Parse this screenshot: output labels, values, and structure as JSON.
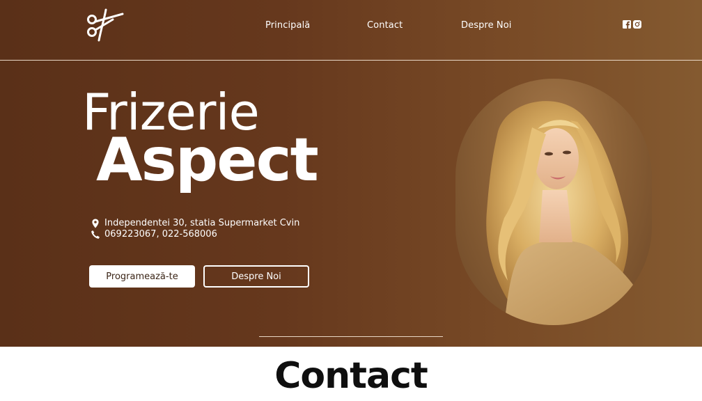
{
  "nav": {
    "links": [
      "Principală",
      "Contact",
      "Despre Noi"
    ],
    "social": [
      "facebook-icon",
      "instagram-icon"
    ]
  },
  "hero": {
    "title_line1": "Frizerie",
    "title_line2": "Aspect",
    "address": "Independentei 30, statia Supermarket Cvin",
    "phones": "069223067, 022-568006",
    "buttons": {
      "primary": "Programează-te",
      "secondary": "Despre Noi"
    }
  },
  "contact": {
    "heading": "Contact"
  },
  "colors": {
    "hero_start": "#5a3018",
    "hero_end": "#845a30",
    "text": "#ffffff",
    "heading": "#0f0f0f"
  }
}
